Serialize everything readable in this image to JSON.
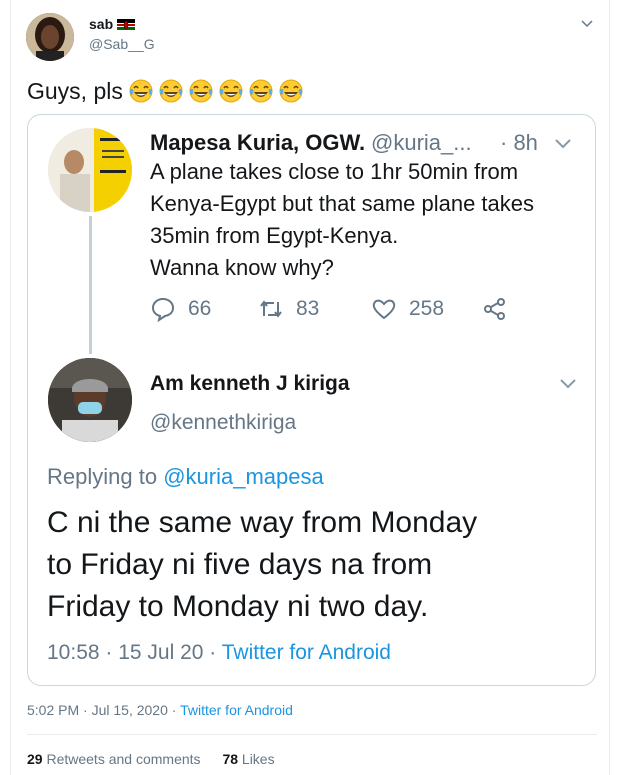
{
  "author": {
    "name": "sab",
    "handle": "@Sab__G"
  },
  "tweet": {
    "text": "Guys, pls",
    "emojis": [
      "face-with-tears-of-joy",
      "face-with-tears-of-joy",
      "face-with-tears-of-joy",
      "face-with-tears-of-joy",
      "face-with-tears-of-joy",
      "face-with-tears-of-joy"
    ],
    "timestamp": "5:02 PM · Jul 15, 2020 · ",
    "source": "Twitter for Android",
    "retweets_count": "29",
    "retweets_label": " Retweets and comments",
    "likes_count": "78",
    "likes_label": " Likes"
  },
  "quoted_parent": {
    "name": "Mapesa Kuria, OGW.",
    "handle": "@kuria_...",
    "time": "· 8h",
    "text_lines": [
      "A plane takes close to 1hr 50min from",
      "Kenya-Egypt but that same plane takes",
      "35min from Egypt-Kenya.",
      "Wanna know why?"
    ],
    "replies": "66",
    "retweets": "83",
    "likes": "258"
  },
  "quoted_reply": {
    "name": "Am kenneth J kiriga",
    "handle": "@kennethkiriga",
    "replying_prefix": "Replying to ",
    "replying_handle": "@kuria_mapesa",
    "text_lines": [
      "C ni the same way from Monday",
      "to Friday ni five days na from",
      "Friday to Monday ni two day."
    ],
    "meta": "10:58 · 15 Jul 20 · ",
    "source": "Twitter for Android"
  },
  "colors": {
    "link": "#1b95e0",
    "muted": "#657786",
    "border": "#ccd6dd"
  },
  "icons": {
    "reply": "reply-icon",
    "retweet": "retweet-icon",
    "like": "heart-icon",
    "share": "share-icon",
    "more": "chevron-down-icon"
  }
}
